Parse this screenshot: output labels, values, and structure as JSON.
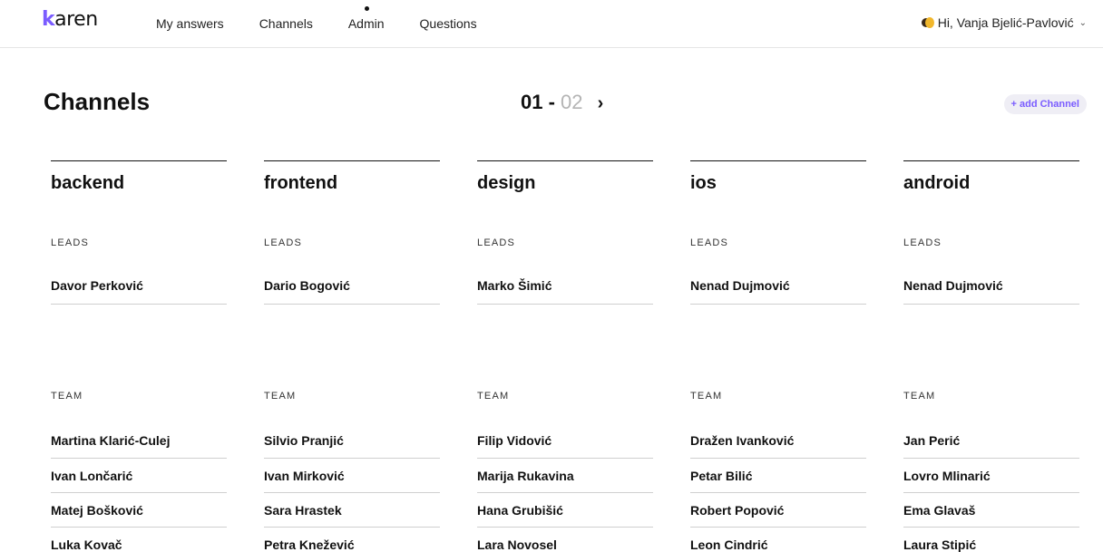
{
  "nav": {
    "logo": "karen",
    "items": [
      {
        "label": "My answers"
      },
      {
        "label": "Channels"
      },
      {
        "label": "Admin"
      },
      {
        "label": "Questions"
      }
    ],
    "user_greeting": "Hi, Vanja Bjelić-Pavlović",
    "user_chevron": "⌄"
  },
  "header": {
    "title": "Channels",
    "pager_current": "01",
    "pager_separator": " - ",
    "pager_total": "02",
    "pager_next": "›",
    "add_button": "+ add Channel"
  },
  "labels": {
    "leads": "LEADS",
    "team": "TEAM"
  },
  "colors": {
    "accent": "#7a5cff",
    "muted_page": "#b4b4b4"
  },
  "channels": [
    {
      "name": "backend",
      "lead": "Davor Perković",
      "team": [
        "Martina Klarić-Culej",
        "Ivan Lončarić",
        "Matej Bošković",
        "Luka Kovač"
      ]
    },
    {
      "name": "frontend",
      "lead": "Dario Bogović",
      "team": [
        "Silvio Pranjić",
        "Ivan Mirković",
        "Sara Hrastek",
        "Petra Knežević"
      ]
    },
    {
      "name": "design",
      "lead": "Marko Šimić",
      "team": [
        "Filip Vidović",
        "Marija Rukavina",
        "Hana Grubišić",
        "Lara Novosel"
      ]
    },
    {
      "name": "ios",
      "lead": "Nenad Dujmović",
      "team": [
        "Dražen Ivanković",
        "Petar Bilić",
        "Robert Popović",
        "Leon Cindrić"
      ]
    },
    {
      "name": "android",
      "lead": "Nenad Dujmović",
      "team": [
        "Jan Perić",
        "Lovro Mlinarić",
        "Ema Glavaš",
        "Laura Stipić"
      ]
    }
  ]
}
